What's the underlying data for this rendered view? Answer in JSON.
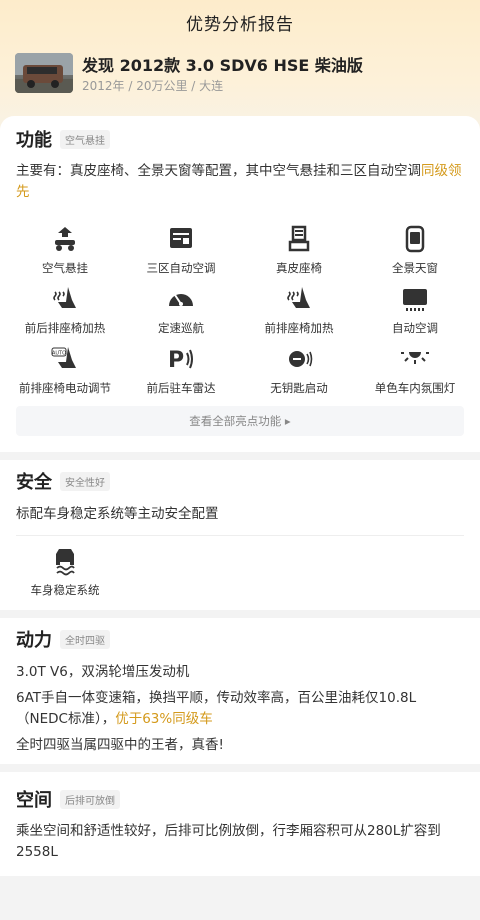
{
  "header": {
    "title": "优势分析报告"
  },
  "car": {
    "name": "发现 2012款 3.0 SDV6 HSE 柴油版",
    "meta": "2012年 / 20万公里 / 大连"
  },
  "features": {
    "title": "功能",
    "tag": "空气悬挂",
    "desc_text": "主要有：真皮座椅、全景天窗等配置，其中空气悬挂和三区自动空调",
    "desc_highlight": "同级领先",
    "items": [
      {
        "label": "空气悬挂",
        "icon": "air-suspension-icon"
      },
      {
        "label": "三区自动空调",
        "icon": "tri-zone-ac-icon"
      },
      {
        "label": "真皮座椅",
        "icon": "leather-seat-icon"
      },
      {
        "label": "全景天窗",
        "icon": "panoramic-sunroof-icon"
      },
      {
        "label": "前后排座椅加热",
        "icon": "heated-seat-icon"
      },
      {
        "label": "定速巡航",
        "icon": "cruise-control-icon"
      },
      {
        "label": "前排座椅加热",
        "icon": "heated-seat-icon"
      },
      {
        "label": "自动空调",
        "icon": "auto-ac-icon"
      },
      {
        "label": "前排座椅电动调节",
        "icon": "power-seat-icon"
      },
      {
        "label": "前后驻车雷达",
        "icon": "parking-radar-icon"
      },
      {
        "label": "无钥匙启动",
        "icon": "keyless-start-icon"
      },
      {
        "label": "单色车内氛围灯",
        "icon": "ambient-light-icon"
      }
    ],
    "more_label": "查看全部亮点功能 ▸"
  },
  "safety": {
    "title": "安全",
    "tag": "安全性好",
    "desc": "标配车身稳定系统等主动安全配置",
    "items": [
      {
        "label": "车身稳定系统",
        "icon": "stability-control-icon"
      }
    ]
  },
  "power": {
    "title": "动力",
    "tag": "全时四驱",
    "line1": "3.0T V6，双涡轮增压发动机",
    "line2_text": "6AT手自一体变速箱，换挡平顺，传动效率高，百公里油耗仅10.8L（NEDC标准），",
    "line2_highlight": "优于63%同级车",
    "line3": "全时四驱当属四驱中的王者，真香!"
  },
  "space": {
    "title": "空间",
    "tag": "后排可放倒",
    "desc": "乘坐空间和舒适性较好，后排可比例放倒，行李厢容积可从280L扩容到2558L"
  },
  "colors": {
    "accent": "#d49a1c",
    "hero_top": "#fdeccb"
  }
}
